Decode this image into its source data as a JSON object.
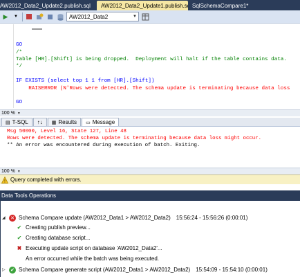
{
  "tabs": [
    {
      "label": "AW2012_Data2_Update2.publish.sql"
    },
    {
      "label": "AW2012_Data2_Update1.publish.sql",
      "close": "×"
    },
    {
      "label": "SqlSchemaCompare1*"
    }
  ],
  "toolbar": {
    "database": "AW2012_Data2"
  },
  "editor": {
    "lines": [
      "GO",
      "/*",
      "Table [HR].[Shift] is being dropped.  Deployment will halt if the table contains data.",
      "*/",
      "IF EXISTS (select top 1 1 from [HR].[Shift])",
      "    RAISERROR (N'Rows were detected. The schema update is terminating because data loss",
      "GO"
    ]
  },
  "zoom1": "100 %",
  "results_tabs": [
    {
      "label": "T-SQL"
    },
    {
      "label": "↑↓"
    },
    {
      "label": "Results"
    },
    {
      "label": "Message"
    }
  ],
  "messages": [
    "Msg 50000, Level 16, State 127, Line 48",
    "Rows were detected. The schema update is terminating because data loss might occur.",
    "** An error was encountered during execution of batch. Exiting."
  ],
  "zoom2": "100 %",
  "status": "Query completed with errors.",
  "dto": {
    "title": "Data Tools Operations",
    "ops": [
      {
        "label": "Schema Compare update (AW2012_Data1 > AW2012_Data2)",
        "time": "15:56:24 - 15:56:26 (0:00:01)"
      },
      {
        "label": "Creating publish preview..."
      },
      {
        "label": "Creating database script..."
      },
      {
        "label": "Executing update script on database 'AW2012_Data2'..."
      },
      {
        "label": "An error occurred while the batch was being executed."
      },
      {
        "label": "Schema Compare generate script (AW2012_Data1 > AW2012_Data2)",
        "time": "15:54:09 - 15:54:10 (0:00:01)"
      }
    ]
  }
}
